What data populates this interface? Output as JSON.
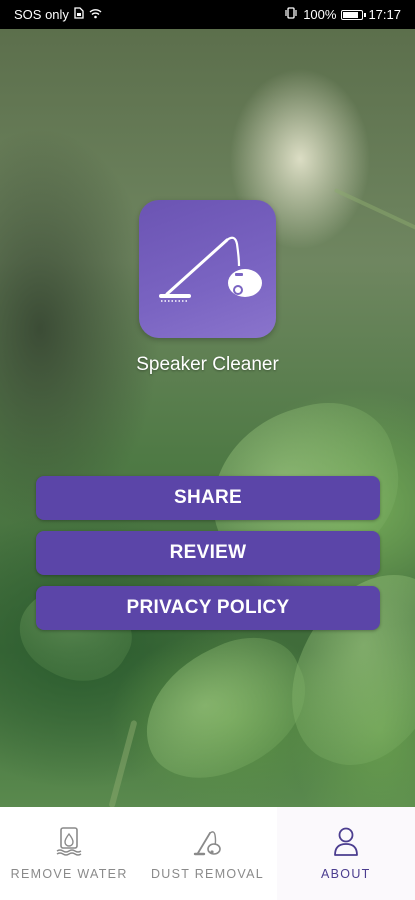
{
  "status_bar": {
    "carrier": "SOS only",
    "battery": "100%",
    "time": "17:17"
  },
  "app": {
    "name": "Speaker Cleaner",
    "logo_icon": "vacuum-cleaner-icon"
  },
  "buttons": {
    "share": "SHARE",
    "review": "REVIEW",
    "privacy_policy": "PRIVACY POLICY"
  },
  "bottom_nav": {
    "items": [
      {
        "label": "REMOVE WATER",
        "icon": "water-drop-speaker-icon",
        "active": false
      },
      {
        "label": "DUST REMOVAL",
        "icon": "vacuum-icon",
        "active": false
      },
      {
        "label": "ABOUT",
        "icon": "person-icon",
        "active": true
      }
    ]
  },
  "colors": {
    "accent": "#5b45a8",
    "active_nav": "#4b3d8f",
    "inactive_nav": "#8a8a8a"
  }
}
